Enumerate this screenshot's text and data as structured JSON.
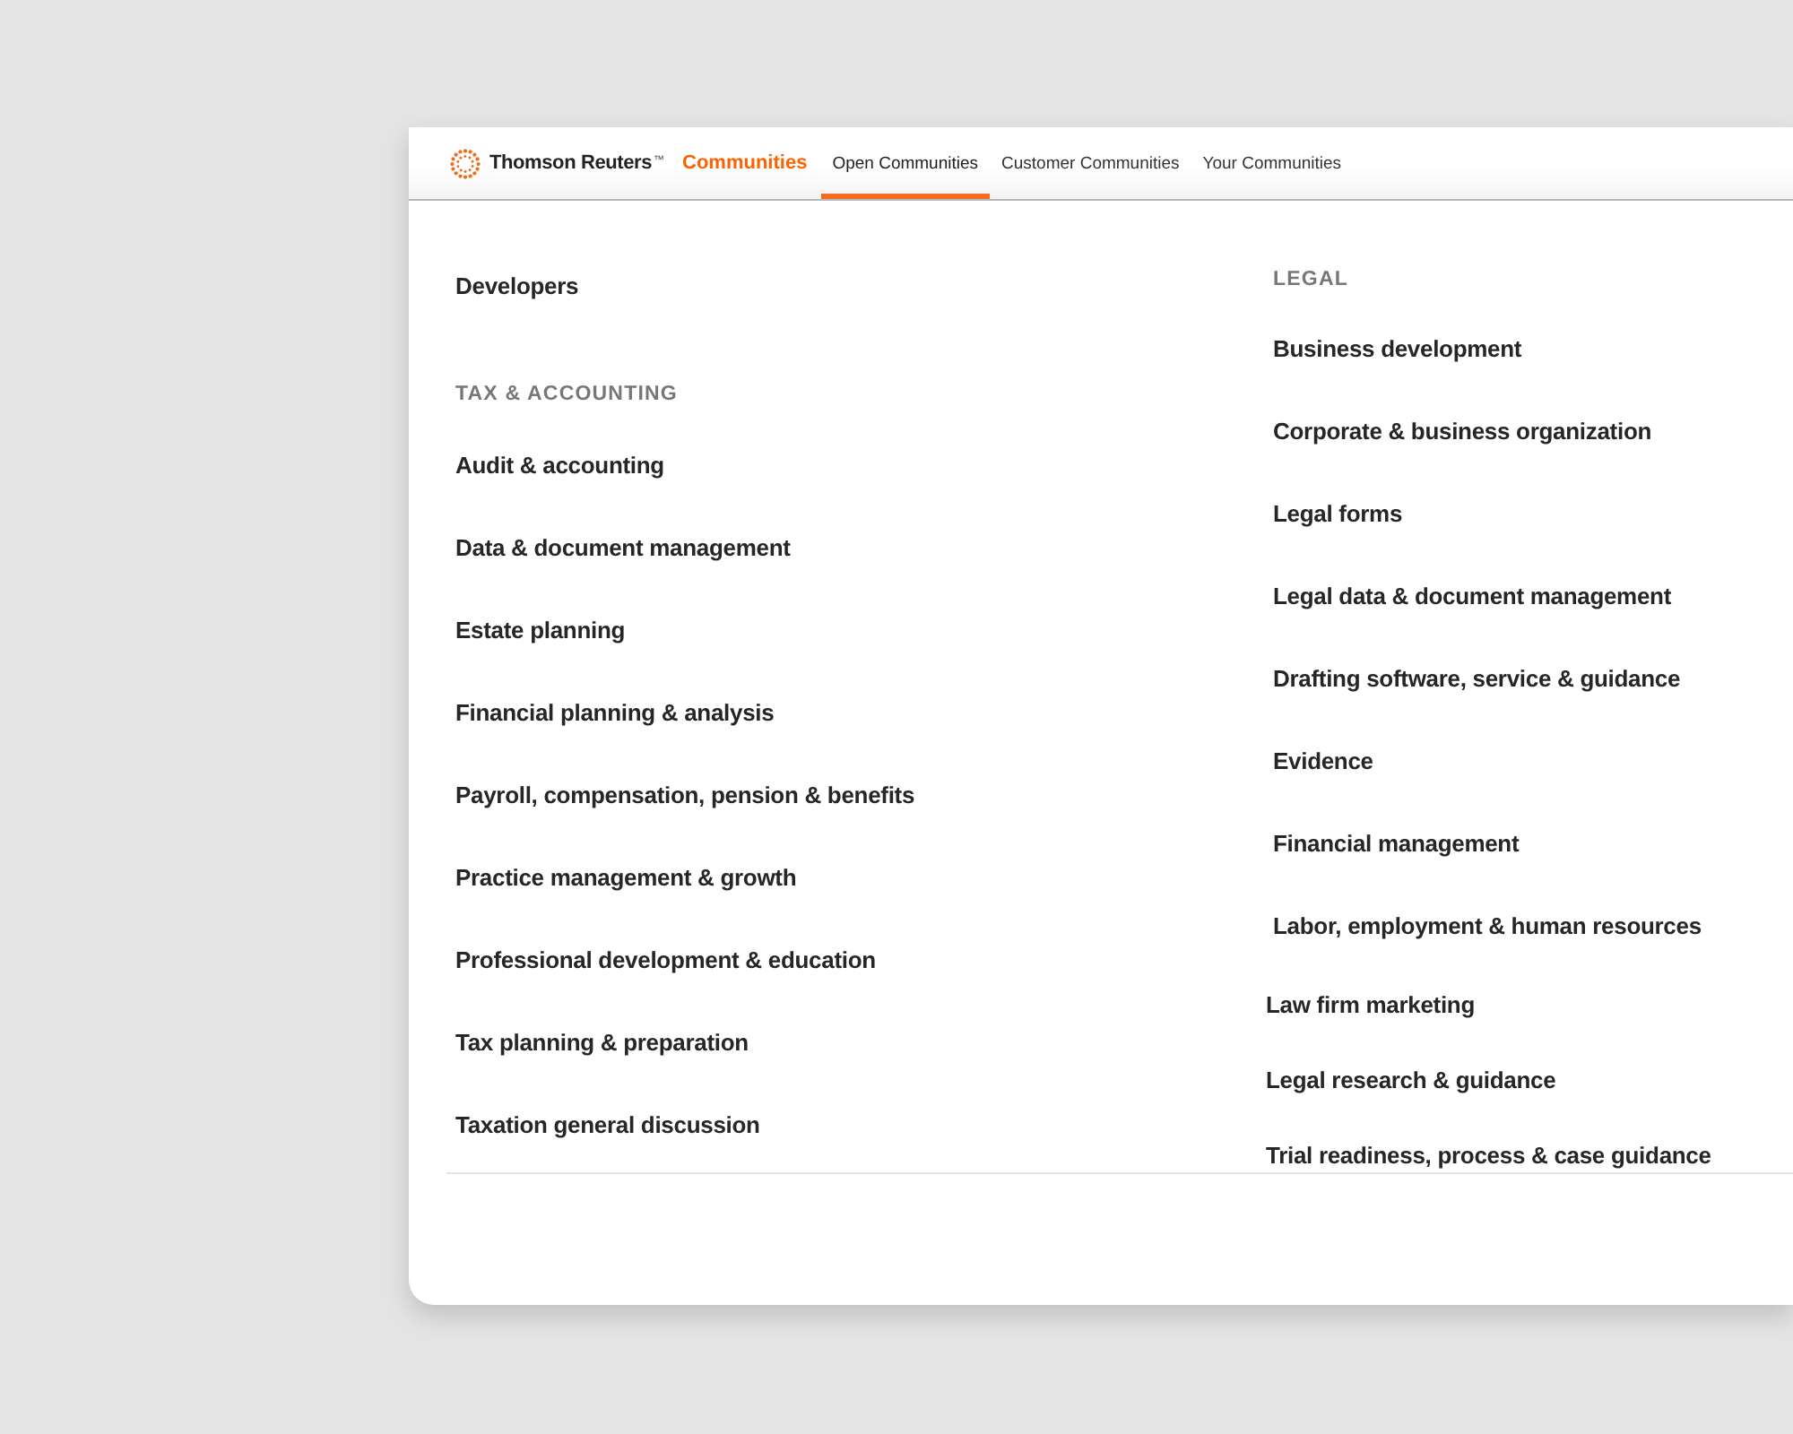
{
  "header": {
    "brand": {
      "name": "Thomson Reuters",
      "trademark": "™"
    },
    "site_title": "Communities",
    "tabs": [
      {
        "label": "Open Communities",
        "selected": true
      },
      {
        "label": "Customer Communities",
        "selected": false
      },
      {
        "label": "Your Communities",
        "selected": false
      }
    ]
  },
  "columns": [
    {
      "entries": [
        {
          "kind": "link",
          "label": "Developers"
        },
        {
          "kind": "heading",
          "label": "TAX & ACCOUNTING"
        },
        {
          "kind": "link",
          "label": "Audit & accounting"
        },
        {
          "kind": "link",
          "label": "Data & document management"
        },
        {
          "kind": "link",
          "label": "Estate planning"
        },
        {
          "kind": "link",
          "label": "Financial planning & analysis"
        },
        {
          "kind": "link",
          "label": "Payroll, compensation, pension & benefits"
        },
        {
          "kind": "link",
          "label": "Practice management & growth"
        },
        {
          "kind": "link",
          "label": "Professional development & education"
        },
        {
          "kind": "link",
          "label": "Tax planning & preparation"
        },
        {
          "kind": "link",
          "label": "Taxation general discussion"
        }
      ]
    },
    {
      "entries": [
        {
          "kind": "heading",
          "label": "LEGAL"
        },
        {
          "kind": "link",
          "label": "Business development"
        },
        {
          "kind": "link",
          "label": "Corporate & business organization"
        },
        {
          "kind": "link",
          "label": "Legal forms"
        },
        {
          "kind": "link",
          "label": "Legal data & document management"
        },
        {
          "kind": "link",
          "label": "Drafting software, service & guidance"
        },
        {
          "kind": "link",
          "label": "Evidence"
        },
        {
          "kind": "link",
          "label": "Financial management"
        },
        {
          "kind": "link",
          "label": "Labor, employment & human resources"
        },
        {
          "kind": "link",
          "label": "Law firm marketing"
        },
        {
          "kind": "link",
          "label": "Legal research & guidance"
        },
        {
          "kind": "link",
          "label": "Trial readiness, process & case guidance"
        }
      ]
    }
  ]
}
